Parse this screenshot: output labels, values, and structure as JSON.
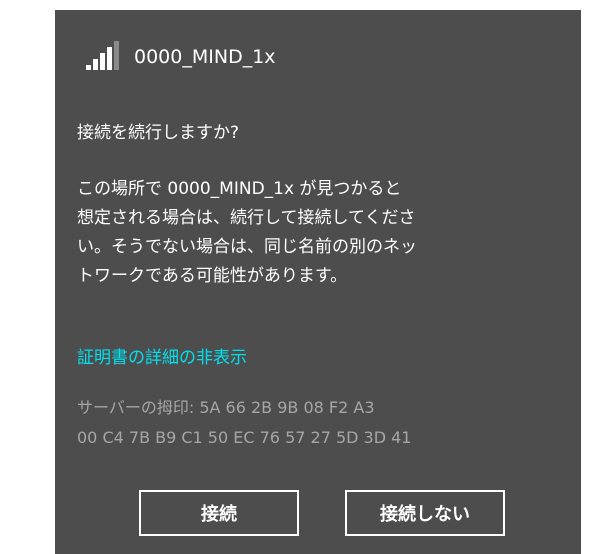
{
  "network": {
    "name": "0000_MIND_1x",
    "signal_icon": "wifi-signal-bars-icon"
  },
  "prompt": {
    "question": "接続を続行しますか?",
    "description_lines": [
      "この場所で 0000_MIND_1x が見つかると",
      "想定される場合は、続行して接続してくださ",
      "い。そうでない場合は、同じ名前の別のネッ",
      "トワークである可能性があります。"
    ]
  },
  "certificate": {
    "toggle_label": "証明書の詳細の非表示",
    "thumbprint_lines": [
      "サーバーの拇印: 5A 66 2B 9B 08 F2 A3",
      "00 C4 7B B9 C1 50 EC 76 57 27 5D 3D 41"
    ]
  },
  "buttons": {
    "connect": "接続",
    "cancel": "接続しない"
  },
  "colors": {
    "panel_background": "#4d4d4d",
    "text": "#ffffff",
    "link": "#00e1ef",
    "muted_text": "#a6a6a6"
  }
}
